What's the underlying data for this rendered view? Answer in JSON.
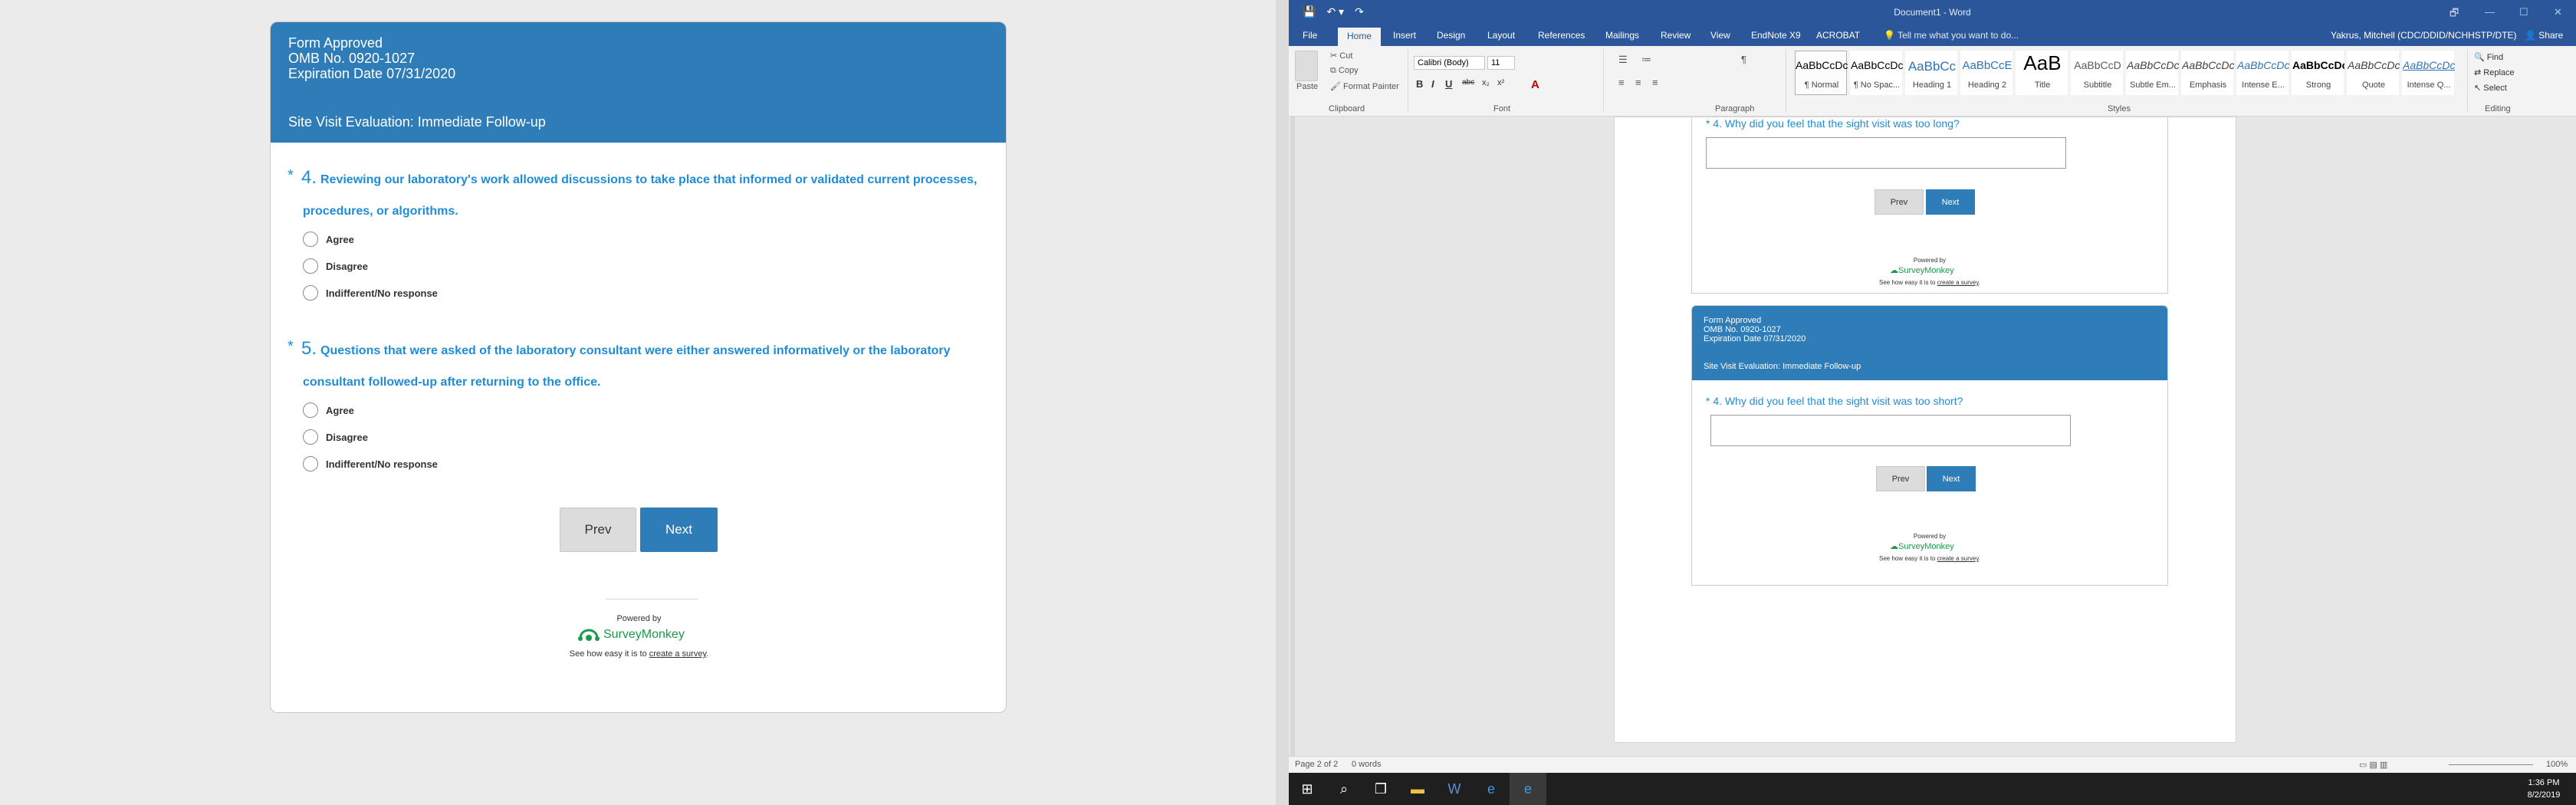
{
  "survey": {
    "header": {
      "line1": "Form Approved",
      "line2": "OMB No. 0920-1027",
      "line3": "Expiration Date 07/31/2020",
      "title": "Site Visit Evaluation: Immediate Follow-up"
    },
    "questions": [
      {
        "star": "*",
        "number": "4.",
        "text_line1": "Reviewing our laboratory's work allowed discussions to take place that informed or validated current processes,",
        "text_line2": "procedures, or algorithms.",
        "options": [
          "Agree",
          "Disagree",
          "Indifferent/No response"
        ]
      },
      {
        "star": "*",
        "number": "5.",
        "text_line1": "Questions that were asked of the laboratory consultant were either answered informatively or the laboratory",
        "text_line2": "consultant followed-up after returning to the office.",
        "options": [
          "Agree",
          "Disagree",
          "Indifferent/No response"
        ]
      }
    ],
    "prev_label": "Prev",
    "next_label": "Next",
    "powered_by": "Powered by",
    "brand": "SurveyMonkey",
    "footer_pre": "See how easy it is to",
    "footer_link": "create a survey",
    "footer_post": "."
  },
  "word": {
    "title": "Document1 - Word",
    "quick_access": [
      "💾",
      "↶ ▾",
      "↷"
    ],
    "window_buttons": [
      "🗗",
      "—",
      "☐",
      "✕"
    ],
    "tabs": [
      "File",
      "Home",
      "Insert",
      "Design",
      "Layout",
      "References",
      "Mailings",
      "Review",
      "View",
      "EndNote X9",
      "ACROBAT"
    ],
    "tell_me": "Tell me what you want to do...",
    "user": "Yakrus, Mitchell (CDC/DDID/NCHHSTP/DTE)",
    "share": "Share",
    "clipboard": {
      "paste": "Paste",
      "cut": "Cut",
      "copy": "Copy",
      "format_painter": "Format Painter",
      "label": "Clipboard"
    },
    "font": {
      "name": "Calibri (Body)",
      "size": "11",
      "label": "Font",
      "buttons": [
        "B",
        "I",
        "U",
        "abc",
        "x₂",
        "x²"
      ]
    },
    "paragraph_label": "Paragraph",
    "styles_label": "Styles",
    "editing_label": "Editing",
    "styles": [
      {
        "preview": "AaBbCcDc",
        "label": "¶ Normal",
        "color": "#000000"
      },
      {
        "preview": "AaBbCcDc",
        "label": "¶ No Spac...",
        "color": "#000000"
      },
      {
        "preview": "AaBbCc",
        "label": "Heading 1",
        "color": "#2e74b5"
      },
      {
        "preview": "AaBbCcE",
        "label": "Heading 2",
        "color": "#2e74b5"
      },
      {
        "preview": "AaB",
        "label": "Title",
        "color": "#000000"
      },
      {
        "preview": "AaBbCcD",
        "label": "Subtitle",
        "color": "#5a5a5a"
      },
      {
        "preview": "AaBbCcDc",
        "label": "Subtle Em...",
        "color": "#404040"
      },
      {
        "preview": "AaBbCcDc",
        "label": "Emphasis",
        "color": "#404040"
      },
      {
        "preview": "AaBbCcDc",
        "label": "Intense E...",
        "color": "#2e74b5"
      },
      {
        "preview": "AaBbCcDc",
        "label": "Strong",
        "color": "#000000"
      },
      {
        "preview": "AaBbCcDc",
        "label": "Quote",
        "color": "#404040"
      },
      {
        "preview": "AaBbCcDc",
        "label": "Intense Q...",
        "color": "#2e74b5"
      }
    ],
    "editing": {
      "find": "Find",
      "replace": "Replace",
      "select": "Select"
    },
    "doc": {
      "embed1_question": "4. Why did you feel that the sight visit was too long?",
      "embed2_header": {
        "line1": "Form Approved",
        "line2": "OMB No. 0920-1027",
        "line3": "Expiration Date 07/31/2020",
        "title": "Site Visit Evaluation: Immediate Follow-up"
      },
      "embed2_question": "4. Why did you feel that the sight visit was too short?",
      "prev": "Prev",
      "next": "Next",
      "powered_by": "Powered by",
      "brand": "SurveyMonkey",
      "footer_pre": "See how easy it is to",
      "footer_link": "create a survey",
      "footer_post": "."
    },
    "status": {
      "page": "Page 2 of 2",
      "words": "0 words",
      "zoom": "100%"
    }
  },
  "taskbar": {
    "time": "1:36 PM",
    "date": "8/2/2019"
  },
  "colors": {
    "survey_blue": "#2e7cb8",
    "question_blue": "#1f8dd6",
    "word_blue": "#2b579a",
    "brand_green": "#1b9b4a"
  }
}
